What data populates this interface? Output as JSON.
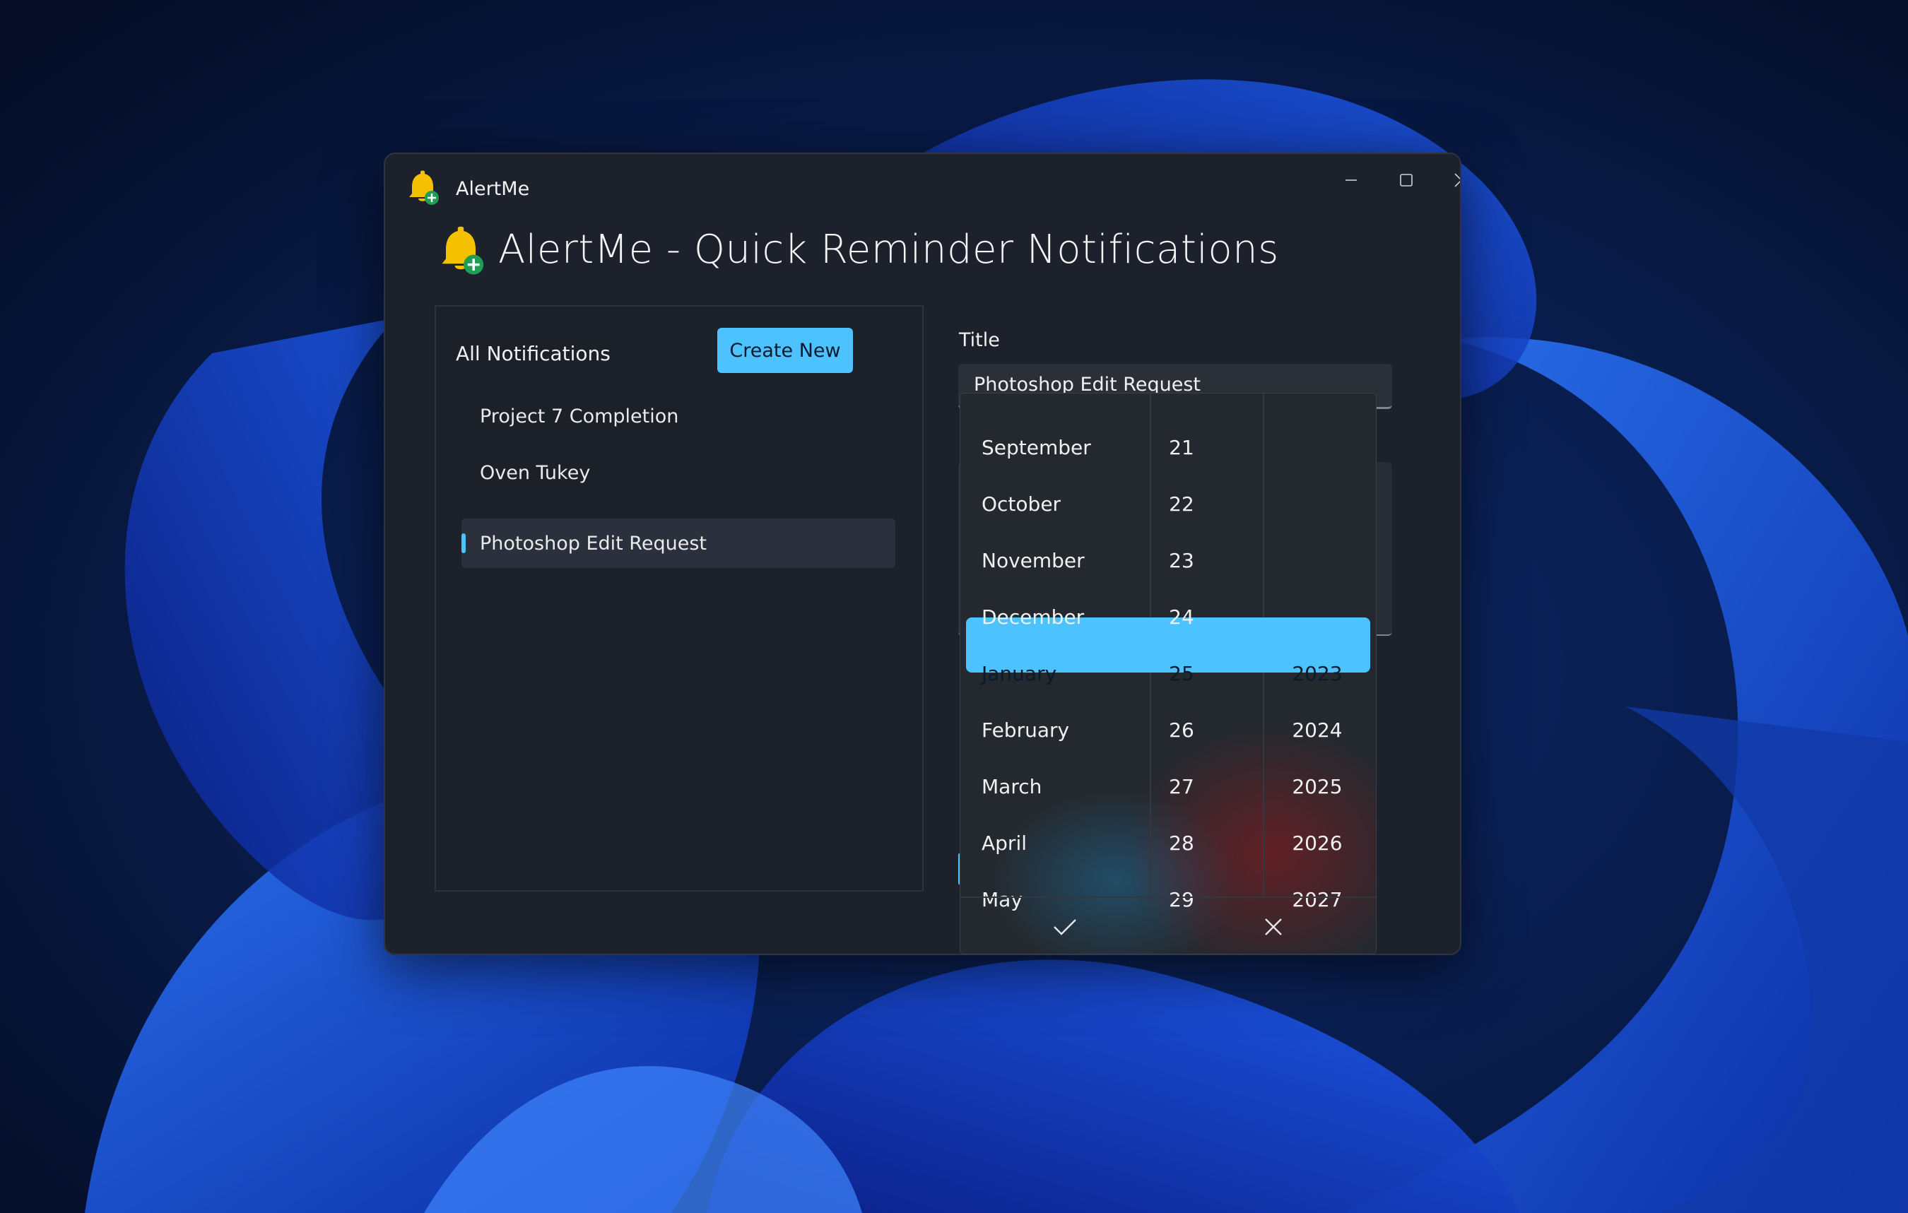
{
  "window": {
    "app_name": "AlertMe",
    "header_title": "AlertMe - Quick Reminder Notifications"
  },
  "sidebar": {
    "heading": "All Notifications",
    "create_button": "Create New",
    "items": [
      {
        "label": "Project 7 Completion"
      },
      {
        "label": "Oven Tukey"
      },
      {
        "label": "Photoshop Edit Request",
        "selected": true
      }
    ]
  },
  "form": {
    "title_label": "Title",
    "title_value": "Photoshop Edit Request"
  },
  "date_picker": {
    "months": [
      "September",
      "October",
      "November",
      "December",
      "January",
      "February",
      "March",
      "April",
      "May"
    ],
    "days": [
      "21",
      "22",
      "23",
      "24",
      "25",
      "26",
      "27",
      "28",
      "29"
    ],
    "years": [
      "",
      "",
      "",
      "",
      "2023",
      "2024",
      "2025",
      "2026",
      "2027"
    ],
    "selected_index": 4,
    "selected": {
      "month": "January",
      "day": "25",
      "year": "2023"
    }
  },
  "colors": {
    "accent": "#4cc2ff",
    "window_bg": "#1c212b",
    "bell": "#f5c000",
    "badge": "#1f9d55"
  },
  "icons": {
    "app": "bell-plus-icon",
    "confirm": "checkmark-icon",
    "dismiss": "close-icon"
  }
}
